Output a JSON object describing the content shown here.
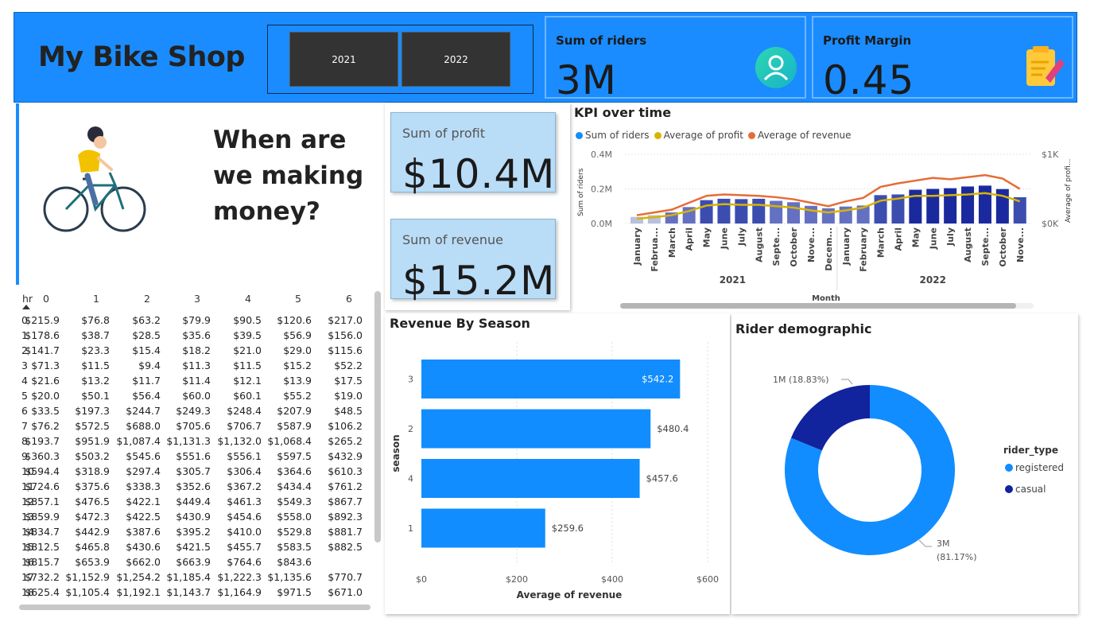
{
  "header": {
    "title": "My Bike Shop",
    "years": [
      "2021",
      "2022"
    ]
  },
  "kpis": {
    "riders": {
      "label": "Sum of riders",
      "value": "3M",
      "icon": "person-icon"
    },
    "margin": {
      "label": "Profit Margin",
      "value": "0.45",
      "icon": "notepad-icon"
    }
  },
  "question": {
    "line1": "When are",
    "line2": "we making",
    "line3": "money?"
  },
  "cards": {
    "profit": {
      "label": "Sum of profit",
      "value": "$10.4M"
    },
    "revenue": {
      "label": "Sum of revenue",
      "value": "$15.2M"
    }
  },
  "table": {
    "row_header": "hr",
    "columns": [
      "0",
      "1",
      "2",
      "3",
      "4",
      "5",
      "6"
    ],
    "rows": [
      [
        "0",
        "$215.9",
        "$76.8",
        "$63.2",
        "$79.9",
        "$90.5",
        "$120.6",
        "$217.0"
      ],
      [
        "1",
        "$178.6",
        "$38.7",
        "$28.5",
        "$35.6",
        "$39.5",
        "$56.9",
        "$156.0"
      ],
      [
        "2",
        "$141.7",
        "$23.3",
        "$15.4",
        "$18.2",
        "$21.0",
        "$29.0",
        "$115.6"
      ],
      [
        "3",
        "$71.3",
        "$11.5",
        "$9.4",
        "$11.3",
        "$11.5",
        "$15.2",
        "$52.2"
      ],
      [
        "4",
        "$21.6",
        "$13.2",
        "$11.7",
        "$11.4",
        "$12.1",
        "$13.9",
        "$17.5"
      ],
      [
        "5",
        "$20.0",
        "$50.1",
        "$56.4",
        "$60.0",
        "$60.1",
        "$55.2",
        "$19.0"
      ],
      [
        "6",
        "$33.5",
        "$197.3",
        "$244.7",
        "$249.3",
        "$248.4",
        "$207.9",
        "$48.5"
      ],
      [
        "7",
        "$76.2",
        "$572.5",
        "$688.0",
        "$705.6",
        "$706.7",
        "$587.9",
        "$106.2"
      ],
      [
        "8",
        "$193.7",
        "$951.9",
        "$1,087.4",
        "$1,131.3",
        "$1,132.0",
        "$1,068.4",
        "$265.2"
      ],
      [
        "9",
        "$360.3",
        "$503.2",
        "$545.6",
        "$551.6",
        "$556.1",
        "$597.5",
        "$432.9"
      ],
      [
        "10",
        "$594.4",
        "$318.9",
        "$297.4",
        "$305.7",
        "$306.4",
        "$364.6",
        "$610.3"
      ],
      [
        "11",
        "$724.6",
        "$375.6",
        "$338.3",
        "$352.6",
        "$367.2",
        "$434.4",
        "$761.2"
      ],
      [
        "12",
        "$857.1",
        "$476.5",
        "$422.1",
        "$449.4",
        "$461.3",
        "$549.3",
        "$867.7"
      ],
      [
        "13",
        "$859.9",
        "$472.3",
        "$422.5",
        "$430.9",
        "$454.6",
        "$558.0",
        "$892.3"
      ],
      [
        "14",
        "$834.7",
        "$442.9",
        "$387.6",
        "$395.2",
        "$410.0",
        "$529.8",
        "$881.7"
      ],
      [
        "15",
        "$812.5",
        "$465.8",
        "$430.6",
        "$421.5",
        "$455.7",
        "$583.5",
        "$882.5"
      ],
      [
        "16",
        "$815.7",
        "$653.9",
        "$662.0",
        "$663.9",
        "$764.6",
        "$843.6"
      ],
      [
        "17",
        "$732.2",
        "$1,152.9",
        "$1,254.2",
        "$1,185.4",
        "$1,222.3",
        "$1,135.6",
        "$770.7"
      ],
      [
        "18",
        "$625.4",
        "$1,105.4",
        "$1,192.1",
        "$1,143.7",
        "$1,164.9",
        "$971.5",
        "$671.0"
      ]
    ]
  },
  "chart_data": [
    {
      "type": "bar",
      "title": "KPI over time",
      "xlabel": "Month",
      "ylabel": "Sum of riders",
      "y2label": "Average of profi...",
      "yticks": [
        "0.0M",
        "0.2M",
        "0.4M"
      ],
      "y2ticks": [
        "$0K",
        "$1K"
      ],
      "ylim": [
        0,
        400000
      ],
      "y2lim": [
        0,
        1000
      ],
      "years": [
        "2021",
        "2022"
      ],
      "categories": [
        "January",
        "Februa...",
        "March",
        "April",
        "May",
        "June",
        "July",
        "August",
        "Septe...",
        "October",
        "Nove...",
        "Decem...",
        "January",
        "February",
        "March",
        "April",
        "May",
        "June",
        "July",
        "August",
        "Septe...",
        "October",
        "Nove..."
      ],
      "series": [
        {
          "name": "Sum of riders",
          "color": "#118dff",
          "values": [
            38000,
            48000,
            64000,
            95000,
            135000,
            143000,
            141000,
            143000,
            131000,
            123000,
            102000,
            88000,
            98000,
            104000,
            164000,
            168000,
            195000,
            200000,
            204000,
            214000,
            219000,
            199000,
            152000
          ]
        },
        {
          "name": "Average of profit",
          "color": "#d9b300",
          "values": [
            70,
            90,
            120,
            180,
            260,
            280,
            270,
            270,
            250,
            230,
            190,
            160,
            190,
            230,
            330,
            360,
            400,
            400,
            410,
            420,
            440,
            400,
            320
          ]
        },
        {
          "name": "Average of revenue",
          "color": "#e66c37",
          "values": [
            120,
            160,
            200,
            300,
            400,
            420,
            410,
            400,
            380,
            350,
            300,
            250,
            320,
            370,
            530,
            580,
            620,
            660,
            640,
            670,
            700,
            650,
            500
          ]
        }
      ],
      "legend": "top-left"
    },
    {
      "type": "bar",
      "title": "Revenue By Season",
      "orientation": "horizontal",
      "xlabel": "Average of revenue",
      "ylabel": "season",
      "categories": [
        "3",
        "2",
        "4",
        "1"
      ],
      "values": [
        542.2,
        480.4,
        457.6,
        259.6
      ],
      "labels": [
        "$542.2",
        "$480.4",
        "$457.6",
        "$259.6"
      ],
      "xticks": [
        "$0",
        "$200",
        "$400",
        "$600"
      ],
      "xlim": [
        0,
        600
      ],
      "color": "#118dff"
    },
    {
      "type": "pie",
      "title": "Rider demographic",
      "donut": true,
      "legend_title": "rider_type",
      "series": [
        {
          "name": "registered",
          "value": 81.17,
          "label_value": "3M",
          "label_pct": "(81.17%)",
          "color": "#118dff"
        },
        {
          "name": "casual",
          "value": 18.83,
          "label": "1M (18.83%)",
          "color": "#12239e"
        }
      ]
    }
  ]
}
